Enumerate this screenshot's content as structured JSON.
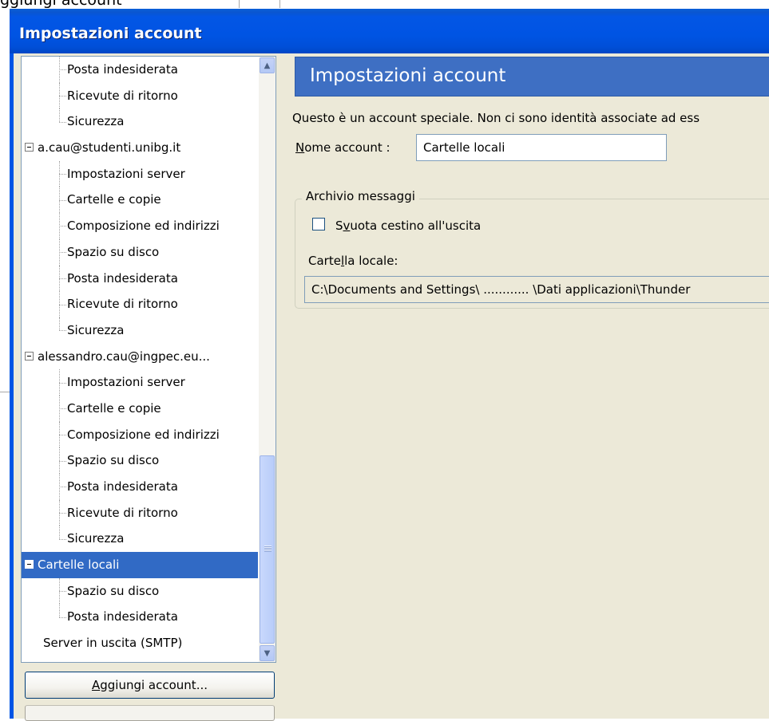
{
  "background": {
    "title_fragment": "ggiungi account"
  },
  "window": {
    "title": "Impostazioni account"
  },
  "tree": {
    "rows": [
      {
        "label": "Posta indesiderata",
        "kind": "child"
      },
      {
        "label": "Ricevute di ritorno",
        "kind": "child"
      },
      {
        "label": "Sicurezza",
        "kind": "child",
        "last": true
      },
      {
        "label": "a.cau@studenti.unibg.it",
        "kind": "parent"
      },
      {
        "label": "Impostazioni server",
        "kind": "child"
      },
      {
        "label": "Cartelle e copie",
        "kind": "child"
      },
      {
        "label": "Composizione ed indirizzi",
        "kind": "child"
      },
      {
        "label": "Spazio su disco",
        "kind": "child"
      },
      {
        "label": "Posta indesiderata",
        "kind": "child"
      },
      {
        "label": "Ricevute di ritorno",
        "kind": "child"
      },
      {
        "label": "Sicurezza",
        "kind": "child",
        "last": true
      },
      {
        "label": "alessandro.cau@ingpec.eu...",
        "kind": "parent"
      },
      {
        "label": "Impostazioni server",
        "kind": "child"
      },
      {
        "label": "Cartelle e copie",
        "kind": "child"
      },
      {
        "label": "Composizione ed indirizzi",
        "kind": "child"
      },
      {
        "label": "Spazio su disco",
        "kind": "child"
      },
      {
        "label": "Posta indesiderata",
        "kind": "child"
      },
      {
        "label": "Ricevute di ritorno",
        "kind": "child"
      },
      {
        "label": "Sicurezza",
        "kind": "child",
        "last": true
      },
      {
        "label": "Cartelle locali",
        "kind": "parent",
        "selected": true
      },
      {
        "label": "Spazio su disco",
        "kind": "child"
      },
      {
        "label": "Posta indesiderata",
        "kind": "child",
        "last": true
      },
      {
        "label": "Server in uscita (SMTP)",
        "kind": "plain"
      }
    ]
  },
  "buttons": {
    "add_account_accel": "A",
    "add_account_rest": "ggiungi account..."
  },
  "panel": {
    "header": "Impostazioni account",
    "description": "Questo è un account speciale. Non ci sono identità associate ad ess",
    "name_label_accel": "N",
    "name_label_rest": "ome account :",
    "name_value": "Cartelle locali",
    "group_title": "Archivio messaggi",
    "checkbox_pre": "S",
    "checkbox_accel": "v",
    "checkbox_post": "uota cestino all'uscita",
    "folder_label_pre": "Carte",
    "folder_label_accel": "l",
    "folder_label_post": "la locale:",
    "folder_path": "C:\\Documents and Settings\\ ............ \\Dati applicazioni\\Thunder"
  },
  "colors": {
    "title_bar": "#0054e3",
    "selection": "#316ac5",
    "header_bar": "#3e6fc3"
  }
}
